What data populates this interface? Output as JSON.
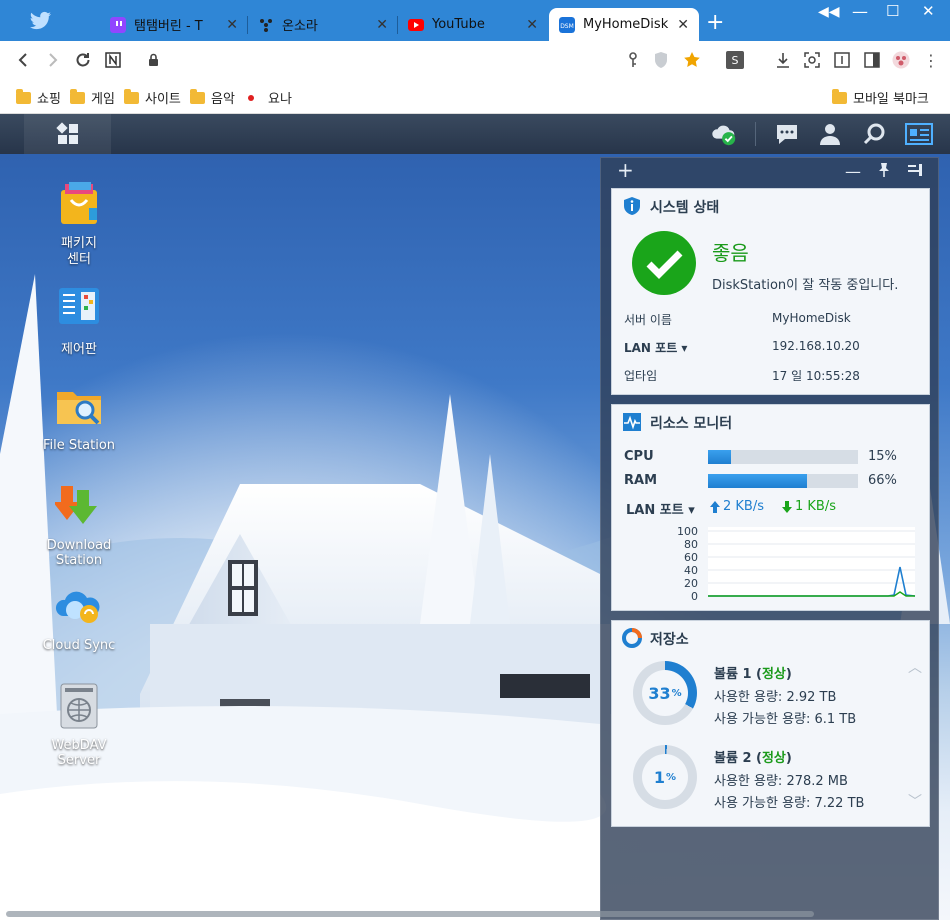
{
  "browser": {
    "tabs": [
      {
        "title": "탬탬버린 - T",
        "favicon": "twitch-icon",
        "color": "#9146ff"
      },
      {
        "title": "온소라",
        "favicon": "onsora-icon",
        "color": "#222222"
      },
      {
        "title": "YouTube",
        "favicon": "youtube-icon",
        "color": "#ff0000"
      },
      {
        "title": "MyHomeDisk",
        "favicon": "dsm-icon",
        "color": "#1a73d9",
        "badge": "DSM"
      }
    ],
    "bookmarks": [
      {
        "label": "쇼핑",
        "icon": "folder-icon"
      },
      {
        "label": "게임",
        "icon": "folder-icon"
      },
      {
        "label": "사이트",
        "icon": "folder-icon"
      },
      {
        "label": "음악",
        "icon": "folder-icon"
      },
      {
        "label": "요나",
        "icon": "red-dot-icon"
      }
    ],
    "mobile_bookmarks": "모바일 북마크",
    "toolbar_s_badge": "S"
  },
  "desktop": {
    "apps": [
      {
        "label": "패키지\n센터",
        "icon": "package-center-icon"
      },
      {
        "label": "제어판",
        "icon": "control-panel-icon"
      },
      {
        "label": "File Station",
        "icon": "file-station-icon"
      },
      {
        "label": "Download Station",
        "icon": "download-station-icon"
      },
      {
        "label": "Cloud Sync",
        "icon": "cloud-sync-icon"
      },
      {
        "label": "WebDAV Server",
        "icon": "webdav-server-icon"
      }
    ]
  },
  "system_status": {
    "title": "시스템 상태",
    "status": "좋음",
    "message": "DiskStation이 잘 작동 중입니다.",
    "rows": [
      {
        "key": "서버 이름",
        "value": "MyHomeDisk"
      },
      {
        "key": "LAN 포트 ▾",
        "value": "192.168.10.20"
      },
      {
        "key": "업타임",
        "value": "17 일 10:55:28"
      }
    ]
  },
  "resource_monitor": {
    "title": "리소스 모니터",
    "cpu_label": "CPU",
    "cpu_percent": 15,
    "cpu_text": "15%",
    "ram_label": "RAM",
    "ram_percent": 66,
    "ram_text": "66%",
    "lan_label": "LAN 포트 ▾",
    "upload": "2 KB/s",
    "download": "1 KB/s",
    "chart_ticks": [
      "100",
      "80",
      "60",
      "40",
      "20",
      "0"
    ]
  },
  "storage": {
    "title": "저장소",
    "volumes": [
      {
        "name": "볼륨 1",
        "state": "정상",
        "percent": 33,
        "used": "사용한 용량: 2.92 TB",
        "free": "사용 가능한 용량: 6.1 TB"
      },
      {
        "name": "볼륨 2",
        "state": "정상",
        "percent": 1,
        "used": "사용한 용량: 278.2 MB",
        "free": "사용 가능한 용량: 7.22 TB"
      }
    ]
  },
  "colors": {
    "accent": "#1f7fd0",
    "good": "#1aa51a",
    "ok_text": "#1a9a1a",
    "tab_strip": "#2f86d6"
  }
}
